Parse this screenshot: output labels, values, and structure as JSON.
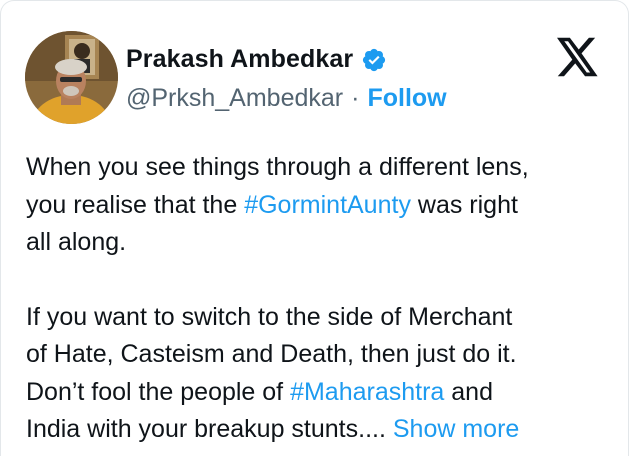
{
  "author": {
    "name": "Prakash Ambedkar",
    "handle": "@Prksh_Ambedkar",
    "separator": "·",
    "follow_label": "Follow",
    "verified_color": "#1d9bf0"
  },
  "brand": {
    "icon": "x-logo-icon"
  },
  "tweet": {
    "p1_line1": "When you see things through a different lens,",
    "p1_line2_pre": "you realise that the ",
    "p1_hashtag": "#GormintAunty",
    "p1_line2_post": " was right",
    "p1_line3": "all along.",
    "p2_line1": "If you want to switch to the side of Merchant",
    "p2_line2": "of Hate, Casteism and Death, then just do it.",
    "p2_line3_pre": "Don’t fool the people of ",
    "p2_hashtag": "#Maharashtra",
    "p2_line3_post": " and",
    "p2_line4": "India with your breakup stunts.... ",
    "show_more_label": "Show more"
  },
  "colors": {
    "link": "#1d9bf0",
    "text": "#0f1419",
    "muted": "#536471"
  }
}
